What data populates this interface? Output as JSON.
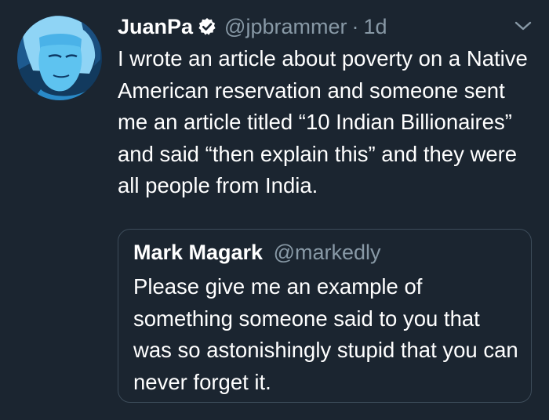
{
  "tweet": {
    "display_name": "JuanPa",
    "handle": "@jpbrammer",
    "separator": "·",
    "time": "1d",
    "text": "I wrote an article about poverty on a Native American reservation and someone sent me an article titled “10 Indian Billionaires” and said “then explain this” and they were all people from India.",
    "avatar_icon": "avatar-illustration",
    "verified_icon": "verified-badge-icon",
    "menu_icon": "chevron-down-icon"
  },
  "quote": {
    "display_name": "Mark Magark",
    "handle": "@markedly",
    "text": "Please give me an example of something someone said to you that was so astonishingly stupid that you can never forget it."
  },
  "colors": {
    "background": "#1b2530",
    "primary_text": "#ffffff",
    "secondary_text": "#8899a6",
    "quote_border": "#3d4c5a",
    "avatar_accent": "#4ab2e8"
  }
}
